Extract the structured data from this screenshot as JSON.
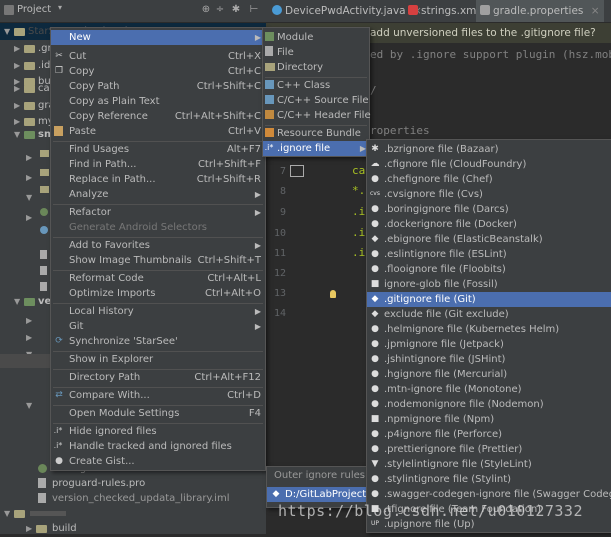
{
  "project_panel": {
    "title": "Project",
    "root": "StarSee",
    "root_path": "D:\\GitLabProject\\StarSee",
    "items": [
      {
        "label": ".gr"
      },
      {
        "label": ".ide"
      },
      {
        "label": "buil"
      },
      {
        "label": "cap"
      },
      {
        "label": "gra"
      },
      {
        "label": "my"
      },
      {
        "label": "sm"
      },
      {
        "label": "ver"
      },
      {
        "label": "build.gradle"
      },
      {
        "label": "proguard-rules.pro"
      },
      {
        "label": "version_checked_updata_library.iml"
      },
      {
        "label": "build"
      }
    ]
  },
  "tabs": [
    {
      "label": "DevicePwdActivity.java",
      "color": "#4a9bd5"
    },
    {
      "label": "strings.xml",
      "color": "#d64040"
    },
    {
      "label": "gradle.properties",
      "color": "#a0a0a0"
    }
  ],
  "banner_text": "add unversioned files to the .gitignore file?",
  "editor": {
    "comment_line": "ed by .ignore support plugin (hsz.mob",
    "lines": [
      "/",
      "roperties",
      "capture",
      "*.iml",
      ".idea/",
      ".idea/",
      ".idea/"
    ],
    "gutter": [
      "7",
      "8",
      "9",
      "10",
      "11",
      "12",
      "13",
      "14"
    ]
  },
  "context_menu": {
    "items": [
      {
        "label": "New",
        "shortcut": ""
      },
      {
        "label": "Cut",
        "shortcut": "Ctrl+X"
      },
      {
        "label": "Copy",
        "shortcut": "Ctrl+C"
      },
      {
        "label": "Copy Path",
        "shortcut": "Ctrl+Shift+C"
      },
      {
        "label": "Copy as Plain Text",
        "shortcut": ""
      },
      {
        "label": "Copy Reference",
        "shortcut": "Ctrl+Alt+Shift+C"
      },
      {
        "label": "Paste",
        "shortcut": "Ctrl+V"
      },
      {
        "label": "Find Usages",
        "shortcut": "Alt+F7"
      },
      {
        "label": "Find in Path...",
        "shortcut": "Ctrl+Shift+F"
      },
      {
        "label": "Replace in Path...",
        "shortcut": "Ctrl+Shift+R"
      },
      {
        "label": "Analyze",
        "shortcut": ""
      },
      {
        "label": "Refactor",
        "shortcut": ""
      },
      {
        "label": "Generate Android Selectors",
        "shortcut": ""
      },
      {
        "label": "Add to Favorites",
        "shortcut": ""
      },
      {
        "label": "Show Image Thumbnails",
        "shortcut": "Ctrl+Shift+T"
      },
      {
        "label": "Reformat Code",
        "shortcut": "Ctrl+Alt+L"
      },
      {
        "label": "Optimize Imports",
        "shortcut": "Ctrl+Alt+O"
      },
      {
        "label": "Local History",
        "shortcut": ""
      },
      {
        "label": "Git",
        "shortcut": ""
      },
      {
        "label": "Synchronize 'StarSee'",
        "shortcut": ""
      },
      {
        "label": "Show in Explorer",
        "shortcut": ""
      },
      {
        "label": "Directory Path",
        "shortcut": "Ctrl+Alt+F12"
      },
      {
        "label": "Compare With...",
        "shortcut": "Ctrl+D"
      },
      {
        "label": "Open Module Settings",
        "shortcut": "F4"
      },
      {
        "label": "Hide ignored files",
        "shortcut": ""
      },
      {
        "label": "Handle tracked and ignored files",
        "shortcut": ""
      },
      {
        "label": "Create Gist...",
        "shortcut": ""
      }
    ]
  },
  "new_menu": {
    "items": [
      {
        "label": "Module"
      },
      {
        "label": "File"
      },
      {
        "label": "Directory"
      },
      {
        "label": "C++ Class"
      },
      {
        "label": "C/C++ Source File"
      },
      {
        "label": "C/C++ Header File"
      },
      {
        "label": "Resource Bundle"
      },
      {
        "label": ".ignore file"
      }
    ]
  },
  "outer_ignore": {
    "title": "Outer ignore rules:",
    "path": "D:/GitLabProject"
  },
  "ignore_menu": {
    "items": [
      {
        "label": ".bzrignore file (Bazaar)",
        "glyph": "✱"
      },
      {
        "label": ".cfignore file (CloudFoundry)",
        "glyph": "☁"
      },
      {
        "label": ".chefignore file (Chef)",
        "glyph": "●"
      },
      {
        "label": ".cvsignore file (Cvs)",
        "glyph": "cvs"
      },
      {
        "label": ".boringignore file (Darcs)",
        "glyph": "●"
      },
      {
        "label": ".dockerignore file (Docker)",
        "glyph": "●"
      },
      {
        "label": ".ebignore file (ElasticBeanstalk)",
        "glyph": "◆"
      },
      {
        "label": ".eslintignore file (ESLint)",
        "glyph": "●"
      },
      {
        "label": ".flooignore file (Floobits)",
        "glyph": "●"
      },
      {
        "label": "ignore-glob file (Fossil)",
        "glyph": "■"
      },
      {
        "label": ".gitignore file (Git)",
        "glyph": "◆"
      },
      {
        "label": "exclude file (Git exclude)",
        "glyph": "◆"
      },
      {
        "label": ".helmignore file (Kubernetes Helm)",
        "glyph": "●"
      },
      {
        "label": ".jpmignore file (Jetpack)",
        "glyph": "●"
      },
      {
        "label": ".jshintignore file (JSHint)",
        "glyph": "●"
      },
      {
        "label": ".hgignore file (Mercurial)",
        "glyph": "●"
      },
      {
        "label": ".mtn-ignore file (Monotone)",
        "glyph": "●"
      },
      {
        "label": ".nodemonignore file (Nodemon)",
        "glyph": "●"
      },
      {
        "label": ".npmignore file (Npm)",
        "glyph": "■"
      },
      {
        "label": ".p4ignore file (Perforce)",
        "glyph": "●"
      },
      {
        "label": ".prettierignore file (Prettier)",
        "glyph": "●"
      },
      {
        "label": ".stylelintignore file (StyleLint)",
        "glyph": "▼"
      },
      {
        "label": ".stylintignore file (Stylint)",
        "glyph": "●"
      },
      {
        "label": ".swagger-codegen-ignore file (Swagger Codegen)",
        "glyph": "●"
      },
      {
        "label": ".tfignore file (Team Foundation)",
        "glyph": "■"
      },
      {
        "label": ".upignore file (Up)",
        "glyph": "UP"
      }
    ]
  },
  "watermark": "https://blog.csdn.net/u010127332"
}
